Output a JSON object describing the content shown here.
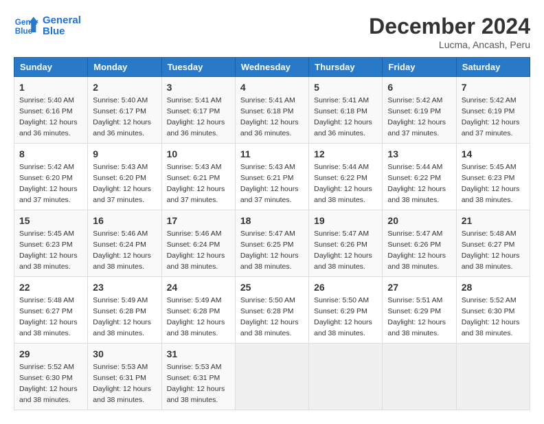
{
  "logo": {
    "line1": "General",
    "line2": "Blue"
  },
  "title": "December 2024",
  "location": "Lucma, Ancash, Peru",
  "days_of_week": [
    "Sunday",
    "Monday",
    "Tuesday",
    "Wednesday",
    "Thursday",
    "Friday",
    "Saturday"
  ],
  "weeks": [
    [
      {
        "day": 1,
        "sunrise": "5:40 AM",
        "sunset": "6:16 PM",
        "daylight": "12 hours and 36 minutes."
      },
      {
        "day": 2,
        "sunrise": "5:40 AM",
        "sunset": "6:17 PM",
        "daylight": "12 hours and 36 minutes."
      },
      {
        "day": 3,
        "sunrise": "5:41 AM",
        "sunset": "6:17 PM",
        "daylight": "12 hours and 36 minutes."
      },
      {
        "day": 4,
        "sunrise": "5:41 AM",
        "sunset": "6:18 PM",
        "daylight": "12 hours and 36 minutes."
      },
      {
        "day": 5,
        "sunrise": "5:41 AM",
        "sunset": "6:18 PM",
        "daylight": "12 hours and 36 minutes."
      },
      {
        "day": 6,
        "sunrise": "5:42 AM",
        "sunset": "6:19 PM",
        "daylight": "12 hours and 37 minutes."
      },
      {
        "day": 7,
        "sunrise": "5:42 AM",
        "sunset": "6:19 PM",
        "daylight": "12 hours and 37 minutes."
      }
    ],
    [
      {
        "day": 8,
        "sunrise": "5:42 AM",
        "sunset": "6:20 PM",
        "daylight": "12 hours and 37 minutes."
      },
      {
        "day": 9,
        "sunrise": "5:43 AM",
        "sunset": "6:20 PM",
        "daylight": "12 hours and 37 minutes."
      },
      {
        "day": 10,
        "sunrise": "5:43 AM",
        "sunset": "6:21 PM",
        "daylight": "12 hours and 37 minutes."
      },
      {
        "day": 11,
        "sunrise": "5:43 AM",
        "sunset": "6:21 PM",
        "daylight": "12 hours and 37 minutes."
      },
      {
        "day": 12,
        "sunrise": "5:44 AM",
        "sunset": "6:22 PM",
        "daylight": "12 hours and 38 minutes."
      },
      {
        "day": 13,
        "sunrise": "5:44 AM",
        "sunset": "6:22 PM",
        "daylight": "12 hours and 38 minutes."
      },
      {
        "day": 14,
        "sunrise": "5:45 AM",
        "sunset": "6:23 PM",
        "daylight": "12 hours and 38 minutes."
      }
    ],
    [
      {
        "day": 15,
        "sunrise": "5:45 AM",
        "sunset": "6:23 PM",
        "daylight": "12 hours and 38 minutes."
      },
      {
        "day": 16,
        "sunrise": "5:46 AM",
        "sunset": "6:24 PM",
        "daylight": "12 hours and 38 minutes."
      },
      {
        "day": 17,
        "sunrise": "5:46 AM",
        "sunset": "6:24 PM",
        "daylight": "12 hours and 38 minutes."
      },
      {
        "day": 18,
        "sunrise": "5:47 AM",
        "sunset": "6:25 PM",
        "daylight": "12 hours and 38 minutes."
      },
      {
        "day": 19,
        "sunrise": "5:47 AM",
        "sunset": "6:26 PM",
        "daylight": "12 hours and 38 minutes."
      },
      {
        "day": 20,
        "sunrise": "5:47 AM",
        "sunset": "6:26 PM",
        "daylight": "12 hours and 38 minutes."
      },
      {
        "day": 21,
        "sunrise": "5:48 AM",
        "sunset": "6:27 PM",
        "daylight": "12 hours and 38 minutes."
      }
    ],
    [
      {
        "day": 22,
        "sunrise": "5:48 AM",
        "sunset": "6:27 PM",
        "daylight": "12 hours and 38 minutes."
      },
      {
        "day": 23,
        "sunrise": "5:49 AM",
        "sunset": "6:28 PM",
        "daylight": "12 hours and 38 minutes."
      },
      {
        "day": 24,
        "sunrise": "5:49 AM",
        "sunset": "6:28 PM",
        "daylight": "12 hours and 38 minutes."
      },
      {
        "day": 25,
        "sunrise": "5:50 AM",
        "sunset": "6:28 PM",
        "daylight": "12 hours and 38 minutes."
      },
      {
        "day": 26,
        "sunrise": "5:50 AM",
        "sunset": "6:29 PM",
        "daylight": "12 hours and 38 minutes."
      },
      {
        "day": 27,
        "sunrise": "5:51 AM",
        "sunset": "6:29 PM",
        "daylight": "12 hours and 38 minutes."
      },
      {
        "day": 28,
        "sunrise": "5:52 AM",
        "sunset": "6:30 PM",
        "daylight": "12 hours and 38 minutes."
      }
    ],
    [
      {
        "day": 29,
        "sunrise": "5:52 AM",
        "sunset": "6:30 PM",
        "daylight": "12 hours and 38 minutes."
      },
      {
        "day": 30,
        "sunrise": "5:53 AM",
        "sunset": "6:31 PM",
        "daylight": "12 hours and 38 minutes."
      },
      {
        "day": 31,
        "sunrise": "5:53 AM",
        "sunset": "6:31 PM",
        "daylight": "12 hours and 38 minutes."
      },
      null,
      null,
      null,
      null
    ]
  ]
}
